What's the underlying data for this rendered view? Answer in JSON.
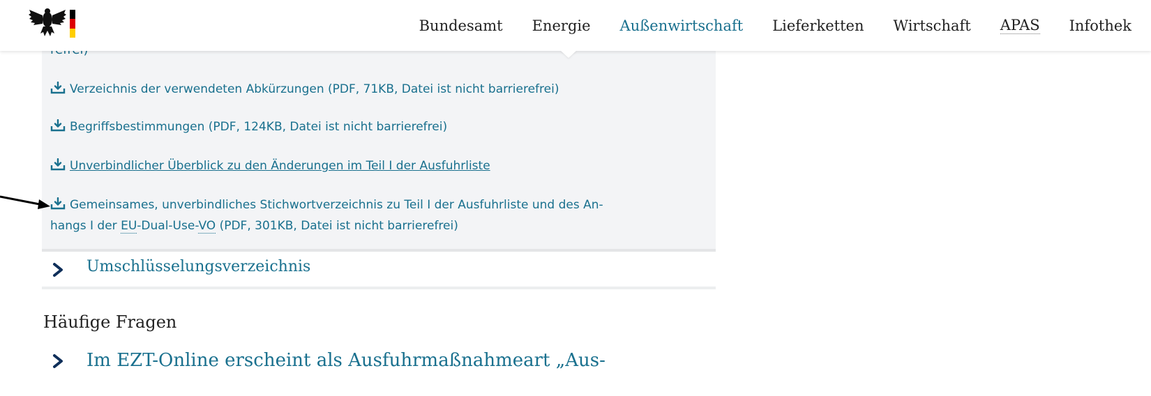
{
  "header": {
    "nav": [
      {
        "label": "Bundesamt",
        "active": false
      },
      {
        "label": "Energie",
        "active": false
      },
      {
        "label": "Außenwirtschaft",
        "active": true
      },
      {
        "label": "Lieferketten",
        "active": false
      },
      {
        "label": "Wirtschaft",
        "active": false
      },
      {
        "label": "APAS",
        "active": false
      },
      {
        "label": "Infothek",
        "active": false
      }
    ]
  },
  "downloads": {
    "truncated_top": "refrei)",
    "items": [
      {
        "label": "Verzeichnis der verwendeten Abkürzungen (PDF, 71KB, Datei ist nicht barrierefrei)"
      },
      {
        "label": "Begriffsbestimmungen (PDF, 124KB, Datei ist nicht barrierefrei)"
      },
      {
        "label": "Unverbindlicher Überblick zu den Änderungen im Teil I der Ausfuhrliste"
      },
      {
        "line1": "Gemeinsames, unverbindliches Stichwortverzeichnis zu Teil I der Ausfuhrliste und des An-",
        "line2_prefix": "hangs I der ",
        "abbr1": "EU",
        "dash": "-Dual-Use-",
        "abbr2": "VO",
        "line2_suffix": " (PDF, 301KB, Datei ist nicht barrierefrei)"
      }
    ]
  },
  "accordion": {
    "label": "Umschlüsselungsverzeichnis"
  },
  "faq": {
    "heading": "Häufige Fragen",
    "item_label": "Im EZT-Online erscheint als Ausfuhrmaßnahmeart „Aus-"
  },
  "colors": {
    "link": "#19708e",
    "panel_bg": "#f3f4f6",
    "text_dark": "#222222"
  }
}
